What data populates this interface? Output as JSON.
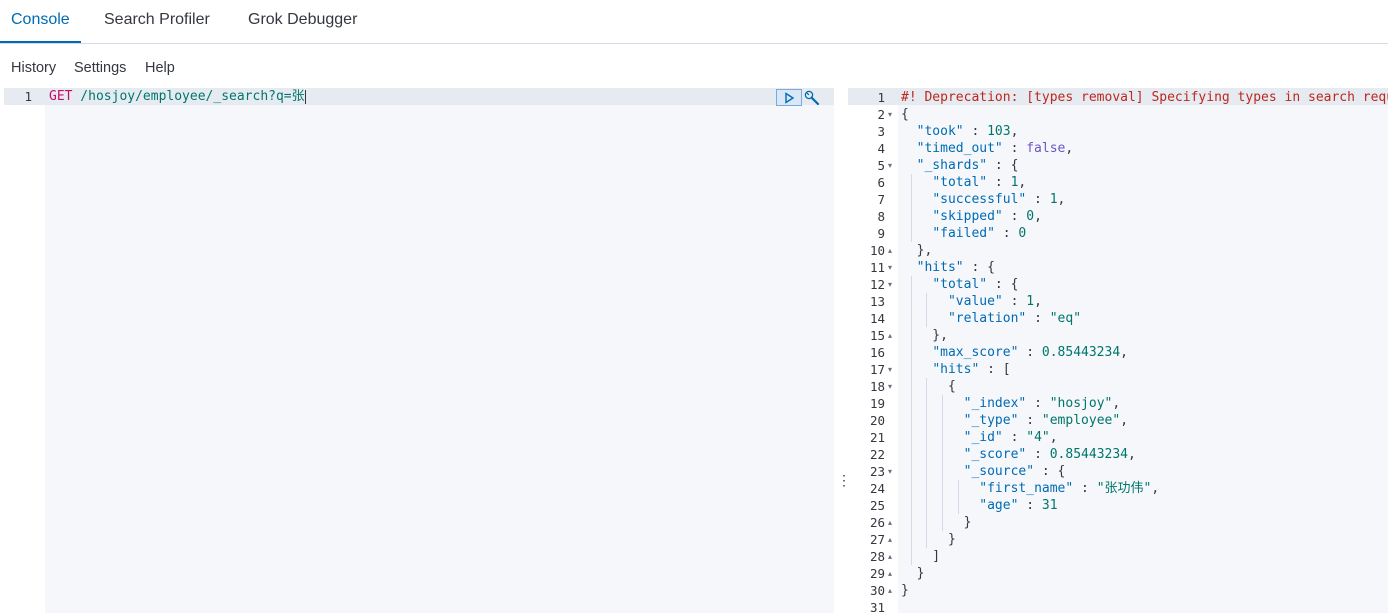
{
  "tabs": [
    "Console",
    "Search Profiler",
    "Grok Debugger"
  ],
  "menu": [
    "History",
    "Settings",
    "Help"
  ],
  "request": {
    "line_number": "1",
    "method": "GET",
    "url": " /hosjoy/employee/_search?q=张"
  },
  "response_lines": [
    [
      {
        "t": "#! Deprecation: [types removal] Specifying types in search reque",
        "c": "dep"
      }
    ],
    [
      {
        "t": "{",
        "c": "p"
      }
    ],
    [
      {
        "t": "  ",
        "c": "p"
      },
      {
        "t": "\"took\"",
        "c": "k"
      },
      {
        "t": " : ",
        "c": "p"
      },
      {
        "t": "103",
        "c": "num"
      },
      {
        "t": ",",
        "c": "p"
      }
    ],
    [
      {
        "t": "  ",
        "c": "p"
      },
      {
        "t": "\"timed_out\"",
        "c": "k"
      },
      {
        "t": " : ",
        "c": "p"
      },
      {
        "t": "false",
        "c": "bool"
      },
      {
        "t": ",",
        "c": "p"
      }
    ],
    [
      {
        "t": "  ",
        "c": "p"
      },
      {
        "t": "\"_shards\"",
        "c": "k"
      },
      {
        "t": " : {",
        "c": "p"
      }
    ],
    [
      {
        "t": "    ",
        "c": "p"
      },
      {
        "t": "\"total\"",
        "c": "k"
      },
      {
        "t": " : ",
        "c": "p"
      },
      {
        "t": "1",
        "c": "num"
      },
      {
        "t": ",",
        "c": "p"
      }
    ],
    [
      {
        "t": "    ",
        "c": "p"
      },
      {
        "t": "\"successful\"",
        "c": "k"
      },
      {
        "t": " : ",
        "c": "p"
      },
      {
        "t": "1",
        "c": "num"
      },
      {
        "t": ",",
        "c": "p"
      }
    ],
    [
      {
        "t": "    ",
        "c": "p"
      },
      {
        "t": "\"skipped\"",
        "c": "k"
      },
      {
        "t": " : ",
        "c": "p"
      },
      {
        "t": "0",
        "c": "num"
      },
      {
        "t": ",",
        "c": "p"
      }
    ],
    [
      {
        "t": "    ",
        "c": "p"
      },
      {
        "t": "\"failed\"",
        "c": "k"
      },
      {
        "t": " : ",
        "c": "p"
      },
      {
        "t": "0",
        "c": "num"
      }
    ],
    [
      {
        "t": "  },",
        "c": "p"
      }
    ],
    [
      {
        "t": "  ",
        "c": "p"
      },
      {
        "t": "\"hits\"",
        "c": "k"
      },
      {
        "t": " : {",
        "c": "p"
      }
    ],
    [
      {
        "t": "    ",
        "c": "p"
      },
      {
        "t": "\"total\"",
        "c": "k"
      },
      {
        "t": " : {",
        "c": "p"
      }
    ],
    [
      {
        "t": "      ",
        "c": "p"
      },
      {
        "t": "\"value\"",
        "c": "k"
      },
      {
        "t": " : ",
        "c": "p"
      },
      {
        "t": "1",
        "c": "num"
      },
      {
        "t": ",",
        "c": "p"
      }
    ],
    [
      {
        "t": "      ",
        "c": "p"
      },
      {
        "t": "\"relation\"",
        "c": "k"
      },
      {
        "t": " : ",
        "c": "p"
      },
      {
        "t": "\"eq\"",
        "c": "str"
      }
    ],
    [
      {
        "t": "    },",
        "c": "p"
      }
    ],
    [
      {
        "t": "    ",
        "c": "p"
      },
      {
        "t": "\"max_score\"",
        "c": "k"
      },
      {
        "t": " : ",
        "c": "p"
      },
      {
        "t": "0.85443234",
        "c": "num"
      },
      {
        "t": ",",
        "c": "p"
      }
    ],
    [
      {
        "t": "    ",
        "c": "p"
      },
      {
        "t": "\"hits\"",
        "c": "k"
      },
      {
        "t": " : [",
        "c": "p"
      }
    ],
    [
      {
        "t": "      {",
        "c": "p"
      }
    ],
    [
      {
        "t": "        ",
        "c": "p"
      },
      {
        "t": "\"_index\"",
        "c": "k"
      },
      {
        "t": " : ",
        "c": "p"
      },
      {
        "t": "\"hosjoy\"",
        "c": "str"
      },
      {
        "t": ",",
        "c": "p"
      }
    ],
    [
      {
        "t": "        ",
        "c": "p"
      },
      {
        "t": "\"_type\"",
        "c": "k"
      },
      {
        "t": " : ",
        "c": "p"
      },
      {
        "t": "\"employee\"",
        "c": "str"
      },
      {
        "t": ",",
        "c": "p"
      }
    ],
    [
      {
        "t": "        ",
        "c": "p"
      },
      {
        "t": "\"_id\"",
        "c": "k"
      },
      {
        "t": " : ",
        "c": "p"
      },
      {
        "t": "\"4\"",
        "c": "str"
      },
      {
        "t": ",",
        "c": "p"
      }
    ],
    [
      {
        "t": "        ",
        "c": "p"
      },
      {
        "t": "\"_score\"",
        "c": "k"
      },
      {
        "t": " : ",
        "c": "p"
      },
      {
        "t": "0.85443234",
        "c": "num"
      },
      {
        "t": ",",
        "c": "p"
      }
    ],
    [
      {
        "t": "        ",
        "c": "p"
      },
      {
        "t": "\"_source\"",
        "c": "k"
      },
      {
        "t": " : {",
        "c": "p"
      }
    ],
    [
      {
        "t": "          ",
        "c": "p"
      },
      {
        "t": "\"first_name\"",
        "c": "k"
      },
      {
        "t": " : ",
        "c": "p"
      },
      {
        "t": "\"张功伟\"",
        "c": "str"
      },
      {
        "t": ",",
        "c": "p"
      }
    ],
    [
      {
        "t": "          ",
        "c": "p"
      },
      {
        "t": "\"age\"",
        "c": "k"
      },
      {
        "t": " : ",
        "c": "p"
      },
      {
        "t": "31",
        "c": "num"
      }
    ],
    [
      {
        "t": "        }",
        "c": "p"
      }
    ],
    [
      {
        "t": "      }",
        "c": "p"
      }
    ],
    [
      {
        "t": "    ]",
        "c": "p"
      }
    ],
    [
      {
        "t": "  }",
        "c": "p"
      }
    ],
    [
      {
        "t": "}",
        "c": "p"
      }
    ],
    []
  ],
  "response_line_numbers": [
    "1",
    "2",
    "3",
    "4",
    "5",
    "6",
    "7",
    "8",
    "9",
    "10",
    "11",
    "12",
    "13",
    "14",
    "15",
    "16",
    "17",
    "18",
    "19",
    "20",
    "21",
    "22",
    "23",
    "24",
    "25",
    "26",
    "27",
    "28",
    "29",
    "30",
    "31"
  ],
  "fold_markers": {
    "2": "▾",
    "5": "▾",
    "10": "▴",
    "11": "▾",
    "12": "▾",
    "15": "▴",
    "17": "▾",
    "18": "▾",
    "23": "▾",
    "26": "▴",
    "27": "▴",
    "28": "▴",
    "29": "▴",
    "30": "▴"
  },
  "resizer_glyph": "⋮",
  "icons": {
    "run": "play-icon",
    "settings": "wrench-icon"
  },
  "colors": {
    "accent": "#006bb4",
    "method": "#c80a68",
    "deprecation": "#bd271e",
    "editor_bg": "#f5f7fa"
  }
}
